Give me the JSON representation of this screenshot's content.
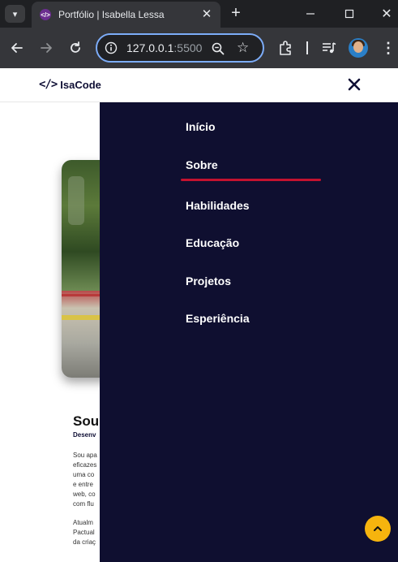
{
  "browser": {
    "tab_title": "Portfólio | Isabella Lessa",
    "url_host": "127.0.0.1",
    "url_port": ":5500"
  },
  "site": {
    "logo_mark": "</>",
    "logo_text": "IsaCode"
  },
  "nav": {
    "items": [
      {
        "label": "Início"
      },
      {
        "label": "Sobre"
      },
      {
        "label": "Habilidades"
      },
      {
        "label": "Educação"
      },
      {
        "label": "Projetos"
      },
      {
        "label": "Esperiência"
      }
    ],
    "active_index": 1,
    "active_color": "#c4122f",
    "background": "#0f0f30"
  },
  "about": {
    "title": "Sou",
    "subtitle": "Desenv",
    "paragraph1": [
      "Sou apa",
      "eficazes",
      "uma co",
      "e entre",
      "web, co",
      "com flu"
    ],
    "paragraph2": [
      "Atualm",
      "Pactual",
      "da criaç"
    ]
  },
  "colors": {
    "accent": "#f6b40e",
    "brand_dark": "#0f0f35"
  }
}
